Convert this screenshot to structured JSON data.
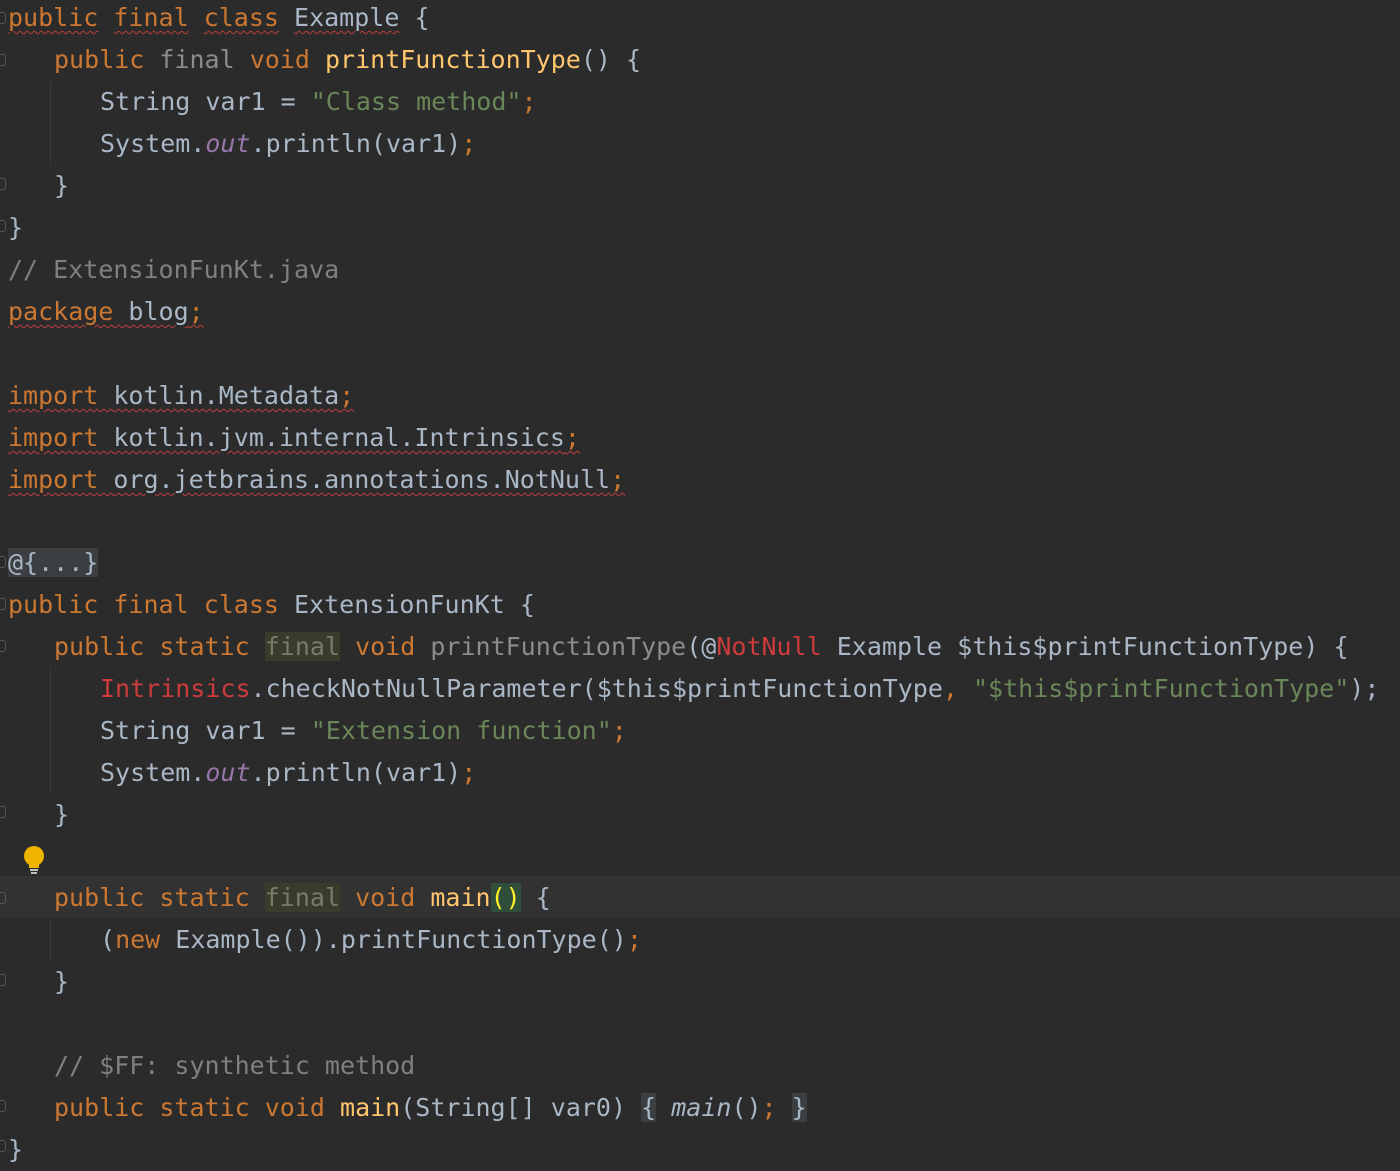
{
  "code": {
    "l1": {
      "t1": "public",
      "t2": "final",
      "t3": "class",
      "t4": "Example",
      "t5": "{"
    },
    "l2": {
      "t1": "public",
      "t2": "final",
      "t3": "void",
      "t4": "printFunctionType",
      "t5": "()",
      "t6": "{"
    },
    "l3": {
      "t1": "String var1 = ",
      "t2": "\"Class method\"",
      "t3": ";"
    },
    "l4": {
      "t1": "System.",
      "t2": "out",
      "t3": ".println(var1)",
      "t4": ";"
    },
    "l5": {
      "t1": "}"
    },
    "l6": {
      "t1": "}"
    },
    "l7": {
      "t1": "// ExtensionFunKt.java"
    },
    "l8": {
      "t1": "package",
      "t2": "blog",
      "t3": ";"
    },
    "l9": {
      "t1": "import",
      "t2": "kotlin.Metadata",
      "t3": ";"
    },
    "l10": {
      "t1": "import",
      "t2": "kotlin.jvm.internal.Intrinsics",
      "t3": ";"
    },
    "l11": {
      "t1": "import",
      "t2": "org.jetbrains.annotations.NotNull",
      "t3": ";"
    },
    "l12": {
      "t1": "@{...}"
    },
    "l13": {
      "t1": "public",
      "t2": "final",
      "t3": "class",
      "t4": "ExtensionFunKt",
      "t5": "{"
    },
    "l14": {
      "t1": "public",
      "t2": "static",
      "t3": "final",
      "t4": "void",
      "t5": "printFunctionType",
      "t6": "(@",
      "t7": "NotNull",
      "t8": " Example $this$printFunctionType) {"
    },
    "l15": {
      "t1": "Intrinsics",
      "t2": ".checkNotNullParameter($this$printFunctionType",
      "t3": ",",
      "t4": "\"$this$printFunctionType\"",
      "t5": ");"
    },
    "l16": {
      "t1": "String var1 = ",
      "t2": "\"Extension function\"",
      "t3": ";"
    },
    "l17": {
      "t1": "System.",
      "t2": "out",
      "t3": ".println(var1)",
      "t4": ";"
    },
    "l18": {
      "t1": "}"
    },
    "l19": {
      "t1": "public",
      "t2": "static",
      "t3": "final",
      "t4": "void",
      "t5": "main",
      "t6": "()",
      "t7": " {"
    },
    "l20": {
      "t1": "(",
      "t2": "new",
      "t3": " Example()).printFunctionType()",
      "t4": ";"
    },
    "l21": {
      "t1": "}"
    },
    "l22": {
      "t1": "// $FF: synthetic method"
    },
    "l23": {
      "t1": "public",
      "t2": "static",
      "t3": "void",
      "t4": "main",
      "t5": "(String[] var0)",
      "t6": "{",
      "t7": "main",
      "t8": "()",
      "t9": ";",
      "t10": "}"
    },
    "l24": {
      "t1": "}"
    }
  },
  "icons": {
    "bulb": "lightbulb-icon",
    "fold": "fold-marker-icon"
  },
  "colors": {
    "background": "#2b2b2b",
    "keyword": "#cc7832",
    "function": "#ffc66d",
    "string": "#6a8759",
    "comment": "#808080",
    "field": "#9876aa",
    "annotation_error": "#cc3c3c",
    "text": "#a9b7c6"
  }
}
